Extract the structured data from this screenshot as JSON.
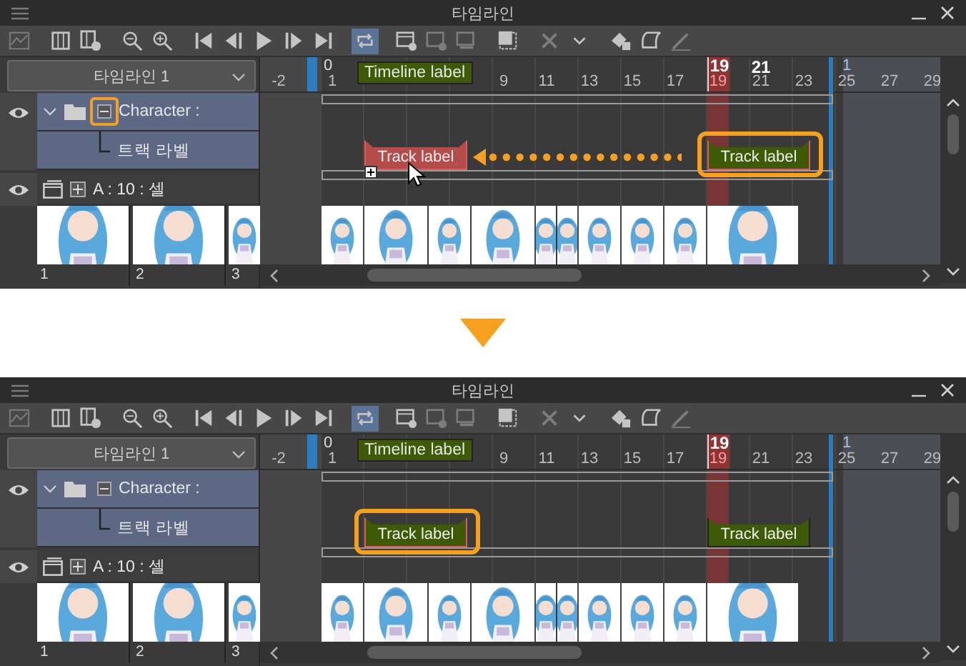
{
  "panels": [
    {
      "title": "타임라인",
      "loop_on": true,
      "timeline_name": "타임라인 1",
      "ruler": [
        {
          "text": "-2"
        },
        {
          "text": "1",
          "marker": "0",
          "kind": "start"
        },
        {
          "text": "9"
        },
        {
          "text": "11"
        },
        {
          "text": "13"
        },
        {
          "text": "15"
        },
        {
          "text": "17"
        },
        {
          "text": "19",
          "marker": "19",
          "kind": "playhead"
        },
        {
          "text": "21",
          "marker": "21",
          "kind": "hover"
        },
        {
          "text": "23"
        },
        {
          "text": "25",
          "marker": "1",
          "kind": "end"
        },
        {
          "text": "27"
        },
        {
          "text": "29"
        }
      ],
      "timeline_label": "Timeline label",
      "layers": [
        {
          "kind": "folder",
          "name": "Character :",
          "expanded": true,
          "selected": true,
          "visible": true,
          "toggle_highlighted": true
        },
        {
          "kind": "track",
          "name": "트랙 라벨",
          "selected": true
        },
        {
          "kind": "animation",
          "name": "A : 10 : 셀",
          "selected": false,
          "visible": true
        }
      ],
      "cells": [
        "1",
        "2",
        "3"
      ],
      "track_labels": [
        {
          "kind": "ghost",
          "text": "Track label",
          "selected": true,
          "highlighted": false
        },
        {
          "kind": "label",
          "text": "Track label",
          "selected": true,
          "highlighted": true
        }
      ],
      "move_arrow": true,
      "cursor": true
    },
    {
      "title": "타임라인",
      "loop_on": true,
      "timeline_name": "타임라인 1",
      "ruler": [
        {
          "text": "-2"
        },
        {
          "text": "1",
          "marker": "0",
          "kind": "start"
        },
        {
          "text": "9"
        },
        {
          "text": "11"
        },
        {
          "text": "13"
        },
        {
          "text": "15"
        },
        {
          "text": "17"
        },
        {
          "text": "19",
          "marker": "19",
          "kind": "playhead"
        },
        {
          "text": "21"
        },
        {
          "text": "23"
        },
        {
          "text": "25",
          "marker": "1",
          "kind": "end"
        },
        {
          "text": "27"
        },
        {
          "text": "29"
        }
      ],
      "timeline_label": "Timeline label",
      "layers": [
        {
          "kind": "folder",
          "name": "Character :",
          "expanded": true,
          "selected": true,
          "visible": true,
          "toggle_highlighted": false
        },
        {
          "kind": "track",
          "name": "트랙 라벨",
          "selected": true
        },
        {
          "kind": "animation",
          "name": "A : 10 : 셀",
          "selected": false,
          "visible": true
        }
      ],
      "cells": [
        "1",
        "2",
        "3"
      ],
      "track_labels": [
        {
          "kind": "label",
          "text": "Track label",
          "selected": true,
          "highlighted": true
        },
        {
          "kind": "label",
          "text": "Track label",
          "selected": false,
          "highlighted": false
        }
      ]
    }
  ]
}
